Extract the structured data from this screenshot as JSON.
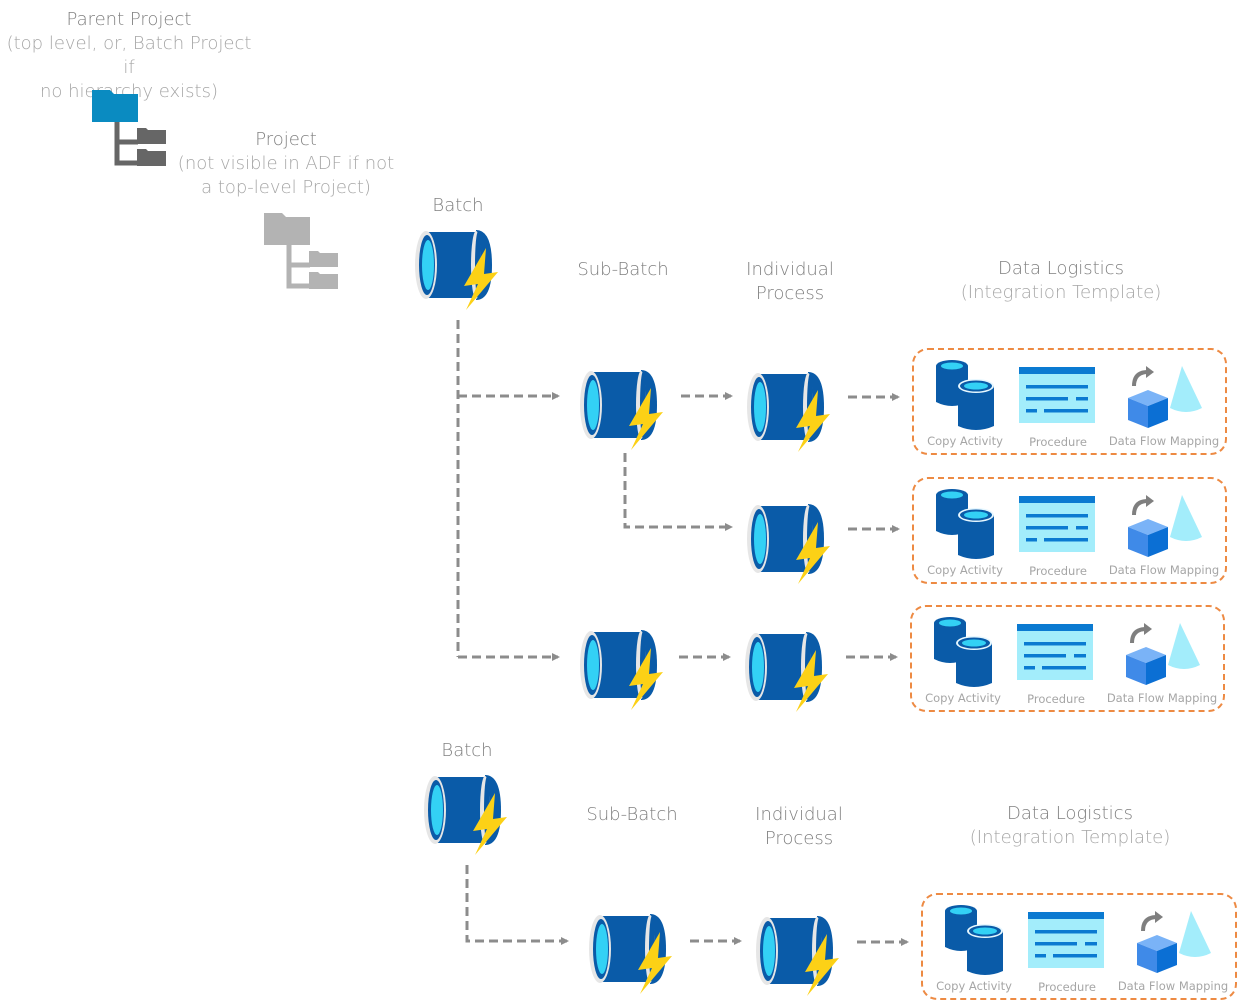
{
  "labels": {
    "parent_project_title": "Parent Project",
    "parent_project_note_1": "(top level, or, Batch Project if",
    "parent_project_note_2": "no hierarchy exists)",
    "project_title": "Project",
    "project_note_1": "(not visible in ADF if not",
    "project_note_2": "a top-level Project)",
    "batch": "Batch",
    "sub_batch": "Sub-Batch",
    "individual_1": "Individual",
    "individual_2": "Process",
    "data_logistics": "Data Logistics",
    "integration_template": "(Integration Template)"
  },
  "template_items": {
    "copy": "Copy Activity",
    "procedure": "Procedure",
    "dataflow": "Data Flow Mapping"
  },
  "colors": {
    "folder_blue": "#0a8bc1",
    "folder_gray": "#666666",
    "folder_light": "#b3b3b3",
    "pipe_blue": "#0a5ba8",
    "pipe_cyan": "#33d1f5",
    "bolt_yellow": "#fcd116",
    "connector_gray": "#8c8c8c",
    "template_border": "#ed8a43"
  }
}
